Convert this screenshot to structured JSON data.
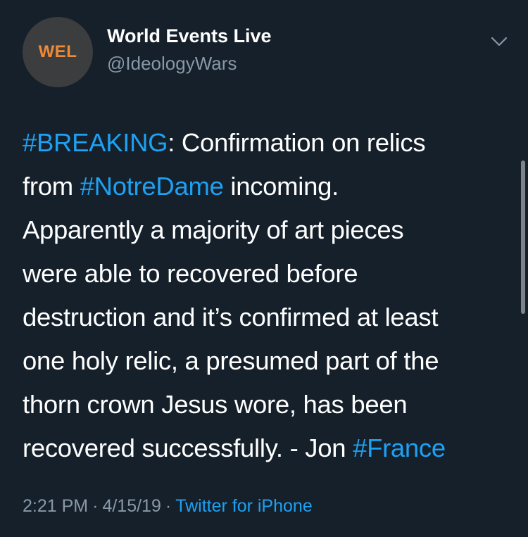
{
  "author": {
    "avatar_text": "WEL",
    "display_name": "World Events Live",
    "handle": "@IdeologyWars"
  },
  "tweet": {
    "lines": [
      [
        {
          "text": "#BREAKING",
          "hashtag": true
        },
        {
          "text": ": Confirmation on relics",
          "hashtag": false
        }
      ],
      [
        {
          "text": "from ",
          "hashtag": false
        },
        {
          "text": "#NotreDame",
          "hashtag": true
        },
        {
          "text": " incoming.",
          "hashtag": false
        }
      ],
      [
        {
          "text": "Apparently a majority of art pieces",
          "hashtag": false
        }
      ],
      [
        {
          "text": "were able to recovered before",
          "hashtag": false
        }
      ],
      [
        {
          "text": "destruction and it’s confirmed at least",
          "hashtag": false
        }
      ],
      [
        {
          "text": "one holy relic, a presumed part of the",
          "hashtag": false
        }
      ],
      [
        {
          "text": "thorn crown Jesus wore, has been",
          "hashtag": false
        }
      ],
      [
        {
          "text": "recovered successfully. - Jon ",
          "hashtag": false
        },
        {
          "text": "#France",
          "hashtag": true
        }
      ]
    ]
  },
  "meta": {
    "time": "2:21 PM",
    "separator": "·",
    "date": "4/15/19",
    "source": "Twitter for iPhone"
  },
  "icons": {
    "menu": "chevron-down-icon"
  },
  "colors": {
    "background": "#15202b",
    "hashtag": "#1da1f2",
    "secondary_text": "#8899a6",
    "avatar_bg": "#3c3d3f",
    "avatar_text": "#f08a34"
  }
}
